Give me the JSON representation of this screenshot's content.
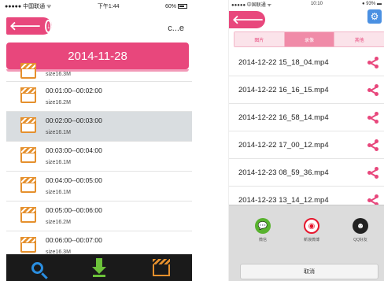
{
  "left": {
    "status": {
      "carrier": "●●●●● 中国联通 ᯤ",
      "time": "下午1:44",
      "battery": "60%"
    },
    "nav": {
      "title": "c...e"
    },
    "date": "2014-11-28",
    "first_row_size": "size16.3M",
    "rows": [
      {
        "range": "00:01:00--00:02:00",
        "size": "size16.2M"
      },
      {
        "range": "00:02:00--00:03:00",
        "size": "size16.1M",
        "selected": true
      },
      {
        "range": "00:03:00--00:04:00",
        "size": "size16.1M"
      },
      {
        "range": "00:04:00--00:05:00",
        "size": "size16.1M"
      },
      {
        "range": "00:05:00--00:06:00",
        "size": "size16.2M"
      },
      {
        "range": "00:06:00--00:07:00",
        "size": "size16.3M"
      }
    ],
    "toolbar": [
      "search-icon",
      "download-icon",
      "clapperboard-icon"
    ]
  },
  "right": {
    "status": {
      "carrier": "●●●●● 中国联通 ᯤ",
      "time": "10:10",
      "battery": "● 93% ▬"
    },
    "tabs": [
      {
        "label": "图片"
      },
      {
        "label": "录像",
        "active": true
      },
      {
        "label": "其他"
      }
    ],
    "files": [
      "2014-12-22 15_18_04.mp4",
      "2014-12-22 16_16_15.mp4",
      "2014-12-22 16_58_14.mp4",
      "2014-12-22 17_00_12.mp4",
      "2014-12-23 08_59_36.mp4",
      "2014-12-23 13_14_12.mp4"
    ],
    "share": [
      {
        "label": "微信",
        "icon": "wechat-icon"
      },
      {
        "label": "新浪微博",
        "icon": "weibo-icon"
      },
      {
        "label": "QQ好友",
        "icon": "qq-icon"
      }
    ],
    "cancel": "取消"
  },
  "colors": {
    "accent": "#e8477c",
    "clapper": "#e5902d",
    "search": "#2a8ee0",
    "download": "#6cc23a"
  }
}
